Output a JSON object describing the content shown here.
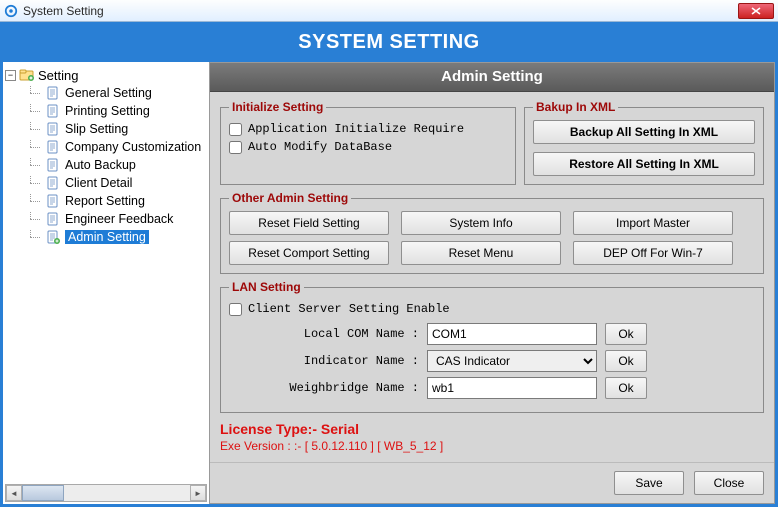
{
  "window": {
    "title": "System Setting"
  },
  "banner": "SYSTEM SETTING",
  "tree": {
    "root": "Setting",
    "items": [
      "General Setting",
      "Printing Setting",
      "Slip Setting",
      "Company Customization",
      "Auto Backup",
      "Client Detail",
      "Report Setting",
      "Engineer Feedback",
      "Admin Setting"
    ],
    "selected": "Admin Setting"
  },
  "panel": {
    "title": "Admin Setting"
  },
  "initialize": {
    "legend": "Initialize Setting",
    "app_init": "Application Initialize Require",
    "auto_modify": "Auto Modify DataBase"
  },
  "backup": {
    "legend": "Bakup In XML",
    "backup_btn": "Backup All Setting In XML",
    "restore_btn": "Restore All Setting In XML"
  },
  "other": {
    "legend": "Other Admin Setting",
    "reset_field": "Reset Field Setting",
    "system_info": "System Info",
    "import_master": "Import Master",
    "reset_comport": "Reset Comport Setting",
    "reset_menu": "Reset Menu",
    "dep_off": "DEP Off For Win-7"
  },
  "lan": {
    "legend": "LAN Setting",
    "client_server": "Client Server Setting Enable",
    "local_com_lbl": "Local COM Name :",
    "local_com_val": "COM1",
    "indicator_lbl": "Indicator Name :",
    "indicator_val": "CAS Indicator",
    "weigh_lbl": "Weighbridge Name :",
    "weigh_val": "wb1",
    "ok": "Ok"
  },
  "license": "License Type:- Serial",
  "exe_version": "Exe Version :  :-  [ 5.0.12.110 ] [ WB_5_12 ]",
  "footer": {
    "save": "Save",
    "close": "Close"
  }
}
